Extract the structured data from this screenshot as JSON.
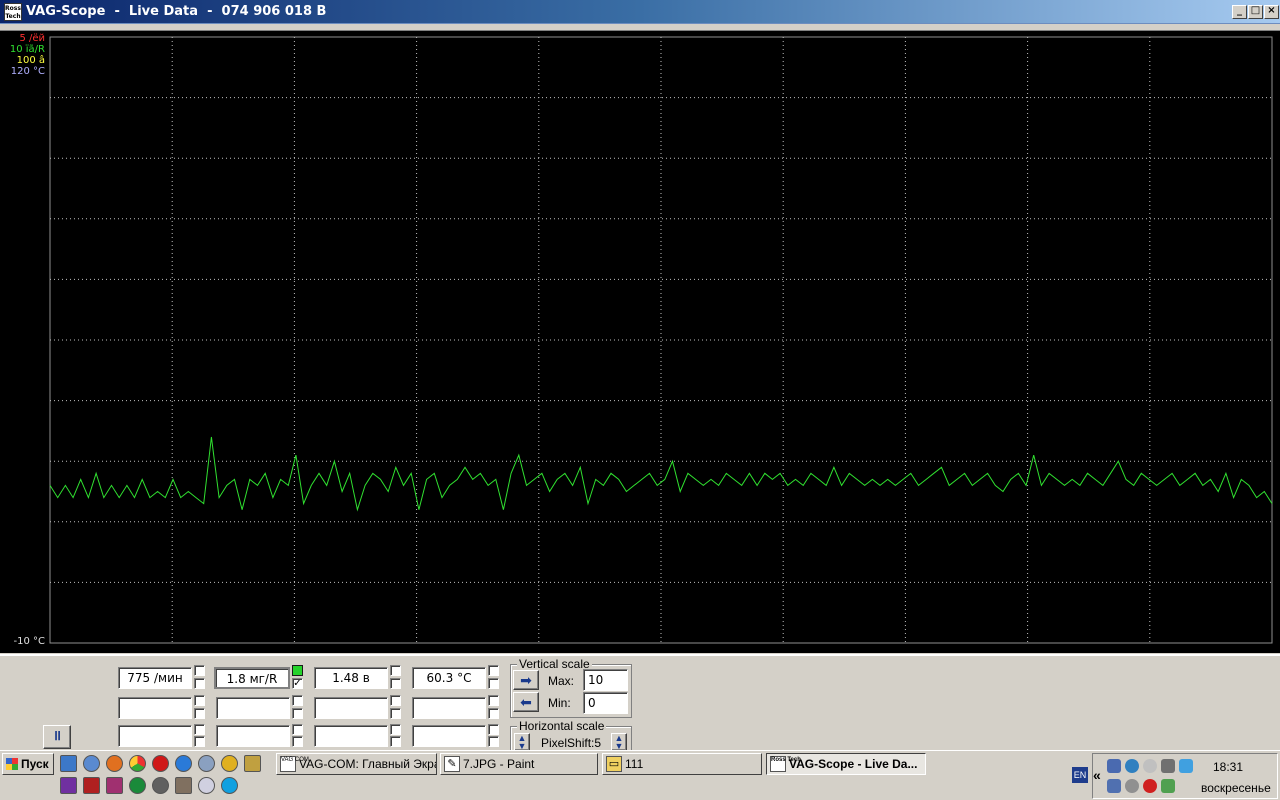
{
  "window": {
    "title": "VAG-Scope  -  Live Data  -  074 906 018 B",
    "icon_label": "Ross Tech",
    "controls": {
      "minimize": "_",
      "maximize": "□",
      "close": "×"
    }
  },
  "scope": {
    "scale_labels_top": [
      {
        "text": "5 /ёй",
        "color": "#ff3030"
      },
      {
        "text": "10 їã/R",
        "color": "#30e030"
      },
      {
        "text": "100 â",
        "color": "#ffff40"
      },
      {
        "text": "120 °C",
        "color": "#b0b0ff"
      }
    ],
    "scale_label_bottom": {
      "text": "-10 °C",
      "color": "#e0e0e0"
    },
    "grid_color": "#c0c0c0",
    "background": "#000000",
    "trace_color": "#30e030",
    "grid_columns": 10,
    "grid_rows": 10,
    "trace_series_norm": [
      0.74,
      0.76,
      0.74,
      0.76,
      0.73,
      0.76,
      0.72,
      0.76,
      0.74,
      0.76,
      0.74,
      0.76,
      0.73,
      0.76,
      0.75,
      0.76,
      0.73,
      0.76,
      0.75,
      0.76,
      0.77,
      0.66,
      0.76,
      0.74,
      0.73,
      0.78,
      0.73,
      0.74,
      0.72,
      0.76,
      0.73,
      0.74,
      0.69,
      0.77,
      0.74,
      0.72,
      0.74,
      0.7,
      0.75,
      0.72,
      0.78,
      0.74,
      0.72,
      0.73,
      0.75,
      0.71,
      0.74,
      0.72,
      0.78,
      0.73,
      0.72,
      0.76,
      0.74,
      0.73,
      0.71,
      0.73,
      0.72,
      0.74,
      0.73,
      0.78,
      0.72,
      0.69,
      0.74,
      0.73,
      0.72,
      0.75,
      0.73,
      0.72,
      0.74,
      0.71,
      0.77,
      0.73,
      0.74,
      0.72,
      0.73,
      0.75,
      0.74,
      0.73,
      0.72,
      0.74,
      0.73,
      0.7,
      0.75,
      0.72,
      0.73,
      0.74,
      0.73,
      0.74,
      0.72,
      0.73,
      0.74,
      0.72,
      0.74,
      0.72,
      0.73,
      0.72,
      0.74,
      0.73,
      0.74,
      0.72,
      0.73,
      0.74,
      0.71,
      0.74,
      0.72,
      0.73,
      0.74,
      0.73,
      0.74,
      0.73,
      0.74,
      0.73,
      0.72,
      0.74,
      0.73,
      0.72,
      0.71,
      0.74,
      0.73,
      0.72,
      0.74,
      0.73,
      0.72,
      0.74,
      0.75,
      0.73,
      0.72,
      0.74,
      0.69,
      0.74,
      0.72,
      0.73,
      0.74,
      0.73,
      0.74,
      0.72,
      0.73,
      0.74,
      0.72,
      0.7,
      0.73,
      0.74,
      0.72,
      0.73,
      0.74,
      0.73,
      0.72,
      0.74,
      0.73,
      0.72,
      0.74,
      0.73,
      0.75,
      0.72,
      0.76,
      0.73,
      0.74,
      0.76,
      0.75,
      0.77
    ]
  },
  "readouts": {
    "row1": [
      "775 /мин",
      "1.8 мг/R",
      "1.48 в",
      "60.3 °C"
    ],
    "row2": [
      "",
      "",
      "",
      ""
    ],
    "row3": [
      "",
      "",
      "",
      ""
    ],
    "checkbox_checked_glyph": "✓"
  },
  "vertical_scale": {
    "label": "Vertical scale",
    "max_label": "Max:",
    "max_value": "10",
    "min_label": "Min:",
    "min_value": "0"
  },
  "horizontal_scale": {
    "label": "Horizontal scale",
    "pixelshift": "PixelShift:5"
  },
  "pause_button": "॥",
  "taskbar": {
    "start_label": "Пуск",
    "tasks": [
      {
        "label": "VAG-COM: Главный Экран",
        "icon": "VAG COM",
        "active": false
      },
      {
        "label": "7.JPG - Paint",
        "icon": "✎",
        "active": false
      },
      {
        "label": "111",
        "icon": "▭",
        "active": false
      },
      {
        "label": "VAG-Scope  -  Live Da...",
        "icon": "Ross Tech",
        "active": true
      }
    ],
    "lang": "EN",
    "chevron": "«",
    "clock_time": "18:31",
    "clock_day": "воскресенье"
  }
}
